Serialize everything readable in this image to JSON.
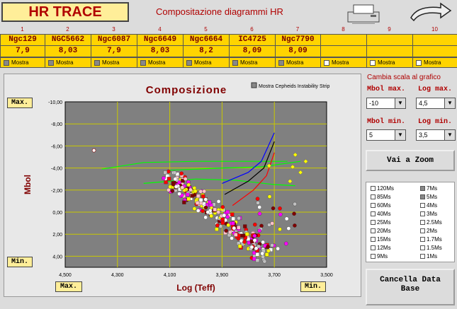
{
  "app": {
    "title": "HR TRACE",
    "subtitle": "Compositazione diagrammi  HR"
  },
  "columns": [
    {
      "num": "1",
      "name": "Ngc129",
      "value": "7,9",
      "show": "Mostra",
      "checked": true
    },
    {
      "num": "2",
      "name": "NGC5662",
      "value": "8,03",
      "show": "Mostra",
      "checked": true
    },
    {
      "num": "3",
      "name": "Ngc6087",
      "value": "7,9",
      "show": "Mostra",
      "checked": true
    },
    {
      "num": "4",
      "name": "Ngc6649",
      "value": "8,03",
      "show": "Mostra",
      "checked": true
    },
    {
      "num": "5",
      "name": "Ngc6664",
      "value": "8,2",
      "show": "Mostra",
      "checked": true
    },
    {
      "num": "6",
      "name": "IC4725",
      "value": "8,09",
      "show": "Mostra",
      "checked": true
    },
    {
      "num": "7",
      "name": "Ngc7790",
      "value": "8,09",
      "show": "Mostra",
      "checked": true
    },
    {
      "num": "8",
      "name": "",
      "value": "",
      "show": "Mostra",
      "checked": false
    },
    {
      "num": "9",
      "name": "",
      "value": "",
      "show": "Mostra",
      "checked": false
    },
    {
      "num": "10",
      "name": "",
      "value": "",
      "show": "Mostra",
      "checked": false
    }
  ],
  "chart": {
    "mostra_cepheids": "Mostra Cepheids Instability Strip",
    "max_label": "Max.",
    "min_label": "Min."
  },
  "chart_data": {
    "type": "scatter",
    "title": "Composizione",
    "xlabel": "Log (Teff)",
    "ylabel": "Mbol",
    "xlim": [
      4.5,
      3.5
    ],
    "ylim": [
      -10,
      5
    ],
    "x_ticks": [
      "4,500",
      "4,300",
      "4,100",
      "3,900",
      "3,700",
      "3,500"
    ],
    "y_ticks": [
      "-10,00",
      "-8,00",
      "-6,00",
      "-4,00",
      "-2,00",
      "0,00",
      "2,00",
      "4,00"
    ],
    "grid": true,
    "plot_bg": "#808080",
    "grid_color": "#c8c800",
    "series_colors": [
      "#800000",
      "#ff00ff",
      "#ffc0cb",
      "#ffffff",
      "#c0c0c0",
      "#ff0000",
      "#ffff00"
    ],
    "tracks": [
      {
        "color": "#00ff00",
        "points": [
          [
            4.36,
            -3.9
          ],
          [
            4.2,
            -4.5
          ],
          [
            4.0,
            -4.6
          ],
          [
            3.8,
            -4.6
          ],
          [
            3.65,
            -4.6
          ]
        ]
      },
      {
        "color": "#00ff00",
        "points": [
          [
            4.2,
            -2.6
          ],
          [
            4.0,
            -3.0
          ],
          [
            3.85,
            -2.9
          ],
          [
            3.7,
            -2.5
          ],
          [
            3.62,
            -2.4
          ]
        ]
      },
      {
        "color": "#00ff00",
        "points": [
          [
            4.1,
            -3.8
          ],
          [
            3.9,
            -4.0
          ],
          [
            3.75,
            -4.1
          ],
          [
            3.6,
            -4.6
          ]
        ]
      },
      {
        "color": "#0000ff",
        "points": [
          [
            3.9,
            -2.6
          ],
          [
            3.8,
            -3.6
          ],
          [
            3.75,
            -4.6
          ],
          [
            3.7,
            -7.2
          ]
        ]
      },
      {
        "color": "#000000",
        "points": [
          [
            3.89,
            -1.6
          ],
          [
            3.8,
            -2.8
          ],
          [
            3.74,
            -4.0
          ],
          [
            3.7,
            -6.4
          ]
        ]
      },
      {
        "color": "#ff0000",
        "points": [
          [
            3.86,
            -0.6
          ],
          [
            3.78,
            -2.0
          ],
          [
            3.73,
            -3.3
          ],
          [
            3.7,
            -5.4
          ]
        ]
      }
    ],
    "points_count_note": ""
  },
  "controls": {
    "scale_title": "Cambia scala al grafico",
    "mbol_max_label": "Mbol max.",
    "log_max_label": "Log max.",
    "mbol_min_label": "Mbol min.",
    "log_min_label": "Log min.",
    "mbol_max_value": "-10",
    "log_max_value": "4,5",
    "mbol_min_value": "5",
    "log_min_value": "3,5",
    "zoom_button": "Vai a Zoom",
    "clear_button_line1": "Cancella Data",
    "clear_button_line2": "Base"
  },
  "masses": [
    {
      "label": "120Ms",
      "checked": false
    },
    {
      "label": "7Ms",
      "checked": true
    },
    {
      "label": "85Ms",
      "checked": false
    },
    {
      "label": "5Ms",
      "checked": true
    },
    {
      "label": "60Ms",
      "checked": false
    },
    {
      "label": "4Ms",
      "checked": false
    },
    {
      "label": "40Ms",
      "checked": false
    },
    {
      "label": "3Ms",
      "checked": false
    },
    {
      "label": "25Ms",
      "checked": false
    },
    {
      "label": "2.5Ms",
      "checked": false
    },
    {
      "label": "20Ms",
      "checked": false
    },
    {
      "label": "2Ms",
      "checked": false
    },
    {
      "label": "15Ms",
      "checked": false
    },
    {
      "label": "1.7Ms",
      "checked": false
    },
    {
      "label": "12Ms",
      "checked": false
    },
    {
      "label": "1.5Ms",
      "checked": false
    },
    {
      "label": "9Ms",
      "checked": false
    },
    {
      "label": "1Ms",
      "checked": false
    }
  ]
}
